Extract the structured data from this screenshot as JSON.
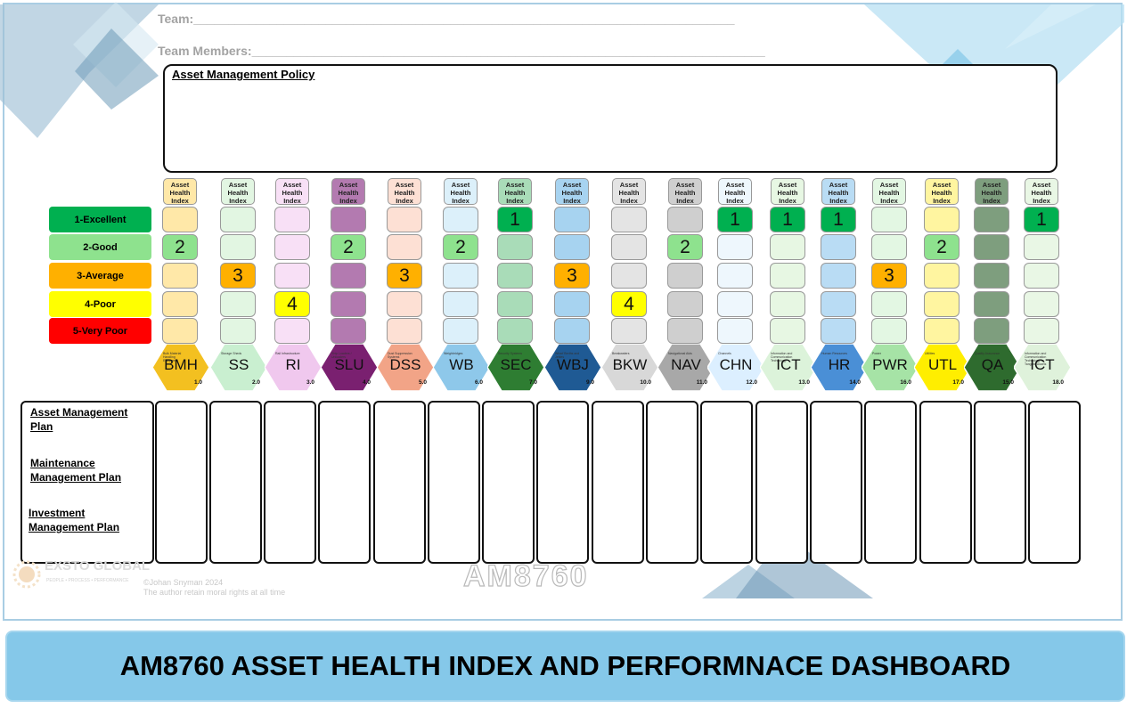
{
  "header": {
    "team_label": "Team:",
    "team_line": "______________________________________________________________________________",
    "members_label": "Team Members:",
    "members_line": "__________________________________________________________________________"
  },
  "policy": {
    "label": "Asset Management Policy"
  },
  "legend": [
    {
      "label": "1-Excellent",
      "color": "#00b050"
    },
    {
      "label": "2-Good",
      "color": "#8ee28e"
    },
    {
      "label": "3-Average",
      "color": "#ffb000"
    },
    {
      "label": "4-Poor",
      "color": "#ffff00"
    },
    {
      "label": "5-Very Poor",
      "color": "#ff0000"
    }
  ],
  "column_header": "Asset Health Index",
  "columns": [
    {
      "code": "BMH",
      "number": "1.0",
      "tiny": "Bulk Material Handling Equipment",
      "light": "#ffe8a8",
      "hex": "#f3c020",
      "rating": "2",
      "rating_row": 1
    },
    {
      "code": "SS",
      "number": "2.0",
      "tiny": "Storage Sheds",
      "light": "#e2f6e2",
      "hex": "#c9efd0",
      "rating": "3",
      "rating_row": 2
    },
    {
      "code": "RI",
      "number": "3.0",
      "tiny": "Rail Infrastructure",
      "light": "#f8e0f6",
      "hex": "#f0c8ee",
      "rating": "4",
      "rating_row": 3
    },
    {
      "code": "SLU",
      "number": "4.0",
      "tiny": "Ship Loaders / Unloaders",
      "light": "#b37ab0",
      "hex": "#7a2070",
      "rating": "2",
      "rating_row": 1
    },
    {
      "code": "DSS",
      "number": "5.0",
      "tiny": "Dust Suppression Systems",
      "light": "#fde0d4",
      "hex": "#f2a487",
      "rating": "3",
      "rating_row": 2
    },
    {
      "code": "WB",
      "number": "6.0",
      "tiny": "Weighbridges",
      "light": "#dcf0fa",
      "hex": "#8ec8ea",
      "rating": "2",
      "rating_row": 1
    },
    {
      "code": "SEC",
      "number": "7.0",
      "tiny": "Security Systems",
      "light": "#a9dcb8",
      "hex": "#2e7d32",
      "rating": "1",
      "rating_row": 0
    },
    {
      "code": "WBJ",
      "number": "9.0",
      "tiny": "Wharf Berths and Jetties",
      "light": "#a7d3f0",
      "hex": "#1f5a94",
      "rating": "3",
      "rating_row": 2
    },
    {
      "code": "BKW",
      "number": "10.0",
      "tiny": "Breakwaters",
      "light": "#e4e4e4",
      "hex": "#d8d8d8",
      "rating": "4",
      "rating_row": 3
    },
    {
      "code": "NAV",
      "number": "11.0",
      "tiny": "Navigational Aids",
      "light": "#cfcfcf",
      "hex": "#a8a8a8",
      "rating": "2",
      "rating_row": 1
    },
    {
      "code": "CHN",
      "number": "12.0",
      "tiny": "Channels",
      "light": "#eef7fd",
      "hex": "#dcefff",
      "rating": "1",
      "rating_row": 0
    },
    {
      "code": "ICT",
      "number": "13.0",
      "tiny": "Information and Communication Technology",
      "light": "#e7f7e3",
      "hex": "#dcf3da",
      "rating": "1",
      "rating_row": 0
    },
    {
      "code": "HR",
      "number": "14.0",
      "tiny": "Human Resources",
      "light": "#b9dcf4",
      "hex": "#4a8fd6",
      "rating": "1",
      "rating_row": 0
    },
    {
      "code": "PWR",
      "number": "16.0",
      "tiny": "Power",
      "light": "#e3f7e3",
      "hex": "#a6e3a6",
      "rating": "3",
      "rating_row": 2
    },
    {
      "code": "UTL",
      "number": "17.0",
      "tiny": "Utilities",
      "light": "#fff5a0",
      "hex": "#ffee00",
      "rating": "2",
      "rating_row": 1
    },
    {
      "code": "QA",
      "number": "15.0",
      "tiny": "Quality Assurance",
      "light": "#7e9e7e",
      "hex": "#2e6b2e",
      "rating": "",
      "rating_row": -1
    },
    {
      "code": "ICT",
      "number": "18.0",
      "tiny": "Information and Communication Technology In Tangible Assets",
      "light": "#e9f7e5",
      "hex": "#dff2db",
      "rating": "1",
      "rating_row": 0
    }
  ],
  "plans": {
    "asset": "Asset Management Plan",
    "maintenance": "Maintenance Management Plan",
    "investment": "Investment Management Plan"
  },
  "footer": {
    "logo_name": "EXSTO GLOBAL",
    "logo_tagline": "PEOPLE • PROCESS • PERFORMANCE",
    "copyright": "©Johan Snyman 2024",
    "rights": "The author retain moral rights at all time",
    "watermark": "AM8760"
  },
  "banner": {
    "title": "AM8760 ASSET HEALTH INDEX AND PERFORMNACE DASHBOARD"
  }
}
